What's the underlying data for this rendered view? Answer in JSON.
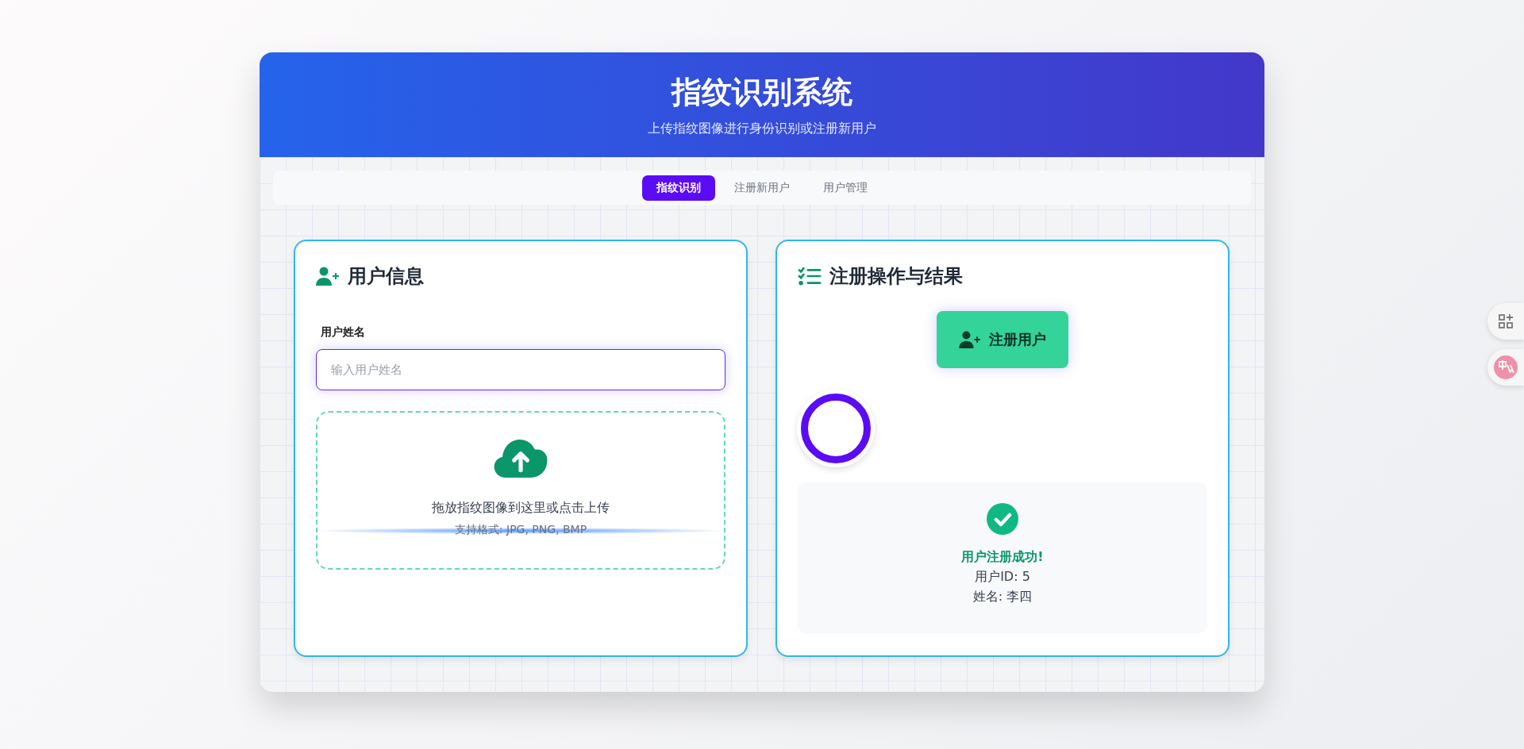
{
  "header": {
    "title": "指纹识别系统",
    "subtitle": "上传指纹图像进行身份识别或注册新用户"
  },
  "tabs": [
    {
      "label": "指纹识别",
      "selected": true
    },
    {
      "label": "注册新用户",
      "selected": false
    },
    {
      "label": "用户管理",
      "selected": false
    }
  ],
  "user_panel": {
    "title": "用户信息",
    "name_field": {
      "label": "用户姓名",
      "placeholder": "输入用户姓名"
    },
    "upload": {
      "prompt": "拖放指纹图像到这里或点击上传",
      "formats": "支持格式: JPG, PNG, BMP"
    }
  },
  "result_panel": {
    "title": "注册操作与结果",
    "button": "注册用户",
    "result": {
      "status": "用户注册成功!",
      "lines": [
        "用户ID: 5",
        "姓名: 李四"
      ]
    }
  }
}
